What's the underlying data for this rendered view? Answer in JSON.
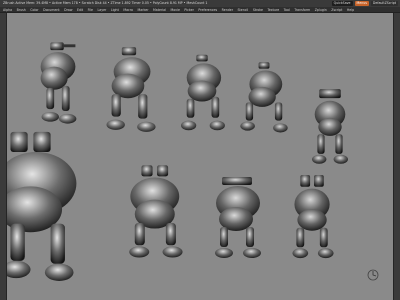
{
  "titlebar": {
    "status_text": "ZBrush  Active Mem: 39.4M8  •  Active Mem 178  •  Scratch Disk 44  •  ZTime 1.892  Timer 0.05  •  PolyCount 8.91 MP  •  MeshCount 1",
    "button_quicksave": "QuickSave",
    "button_menus": "Menus",
    "button_default": "DefaultZScript"
  },
  "menubar": {
    "items": [
      "Alpha",
      "Brush",
      "Color",
      "Document",
      "Draw",
      "Edit",
      "File",
      "Layer",
      "Light",
      "Macro",
      "Marker",
      "Material",
      "Movie",
      "Picker",
      "Preferences",
      "Render",
      "Stencil",
      "Stroke",
      "Texture",
      "Tool",
      "Transform",
      "Zplugin",
      "Zscript",
      "Help"
    ]
  },
  "colors": {
    "canvas_bg": "#8a8a8a",
    "ui_dark": "#2f2f2f",
    "accent_orange": "#c8642a"
  },
  "canvas": {
    "object_count": 9,
    "gizmo_icon": "camera-gizmo-icon",
    "bottom_icon": "rotate-icon"
  }
}
